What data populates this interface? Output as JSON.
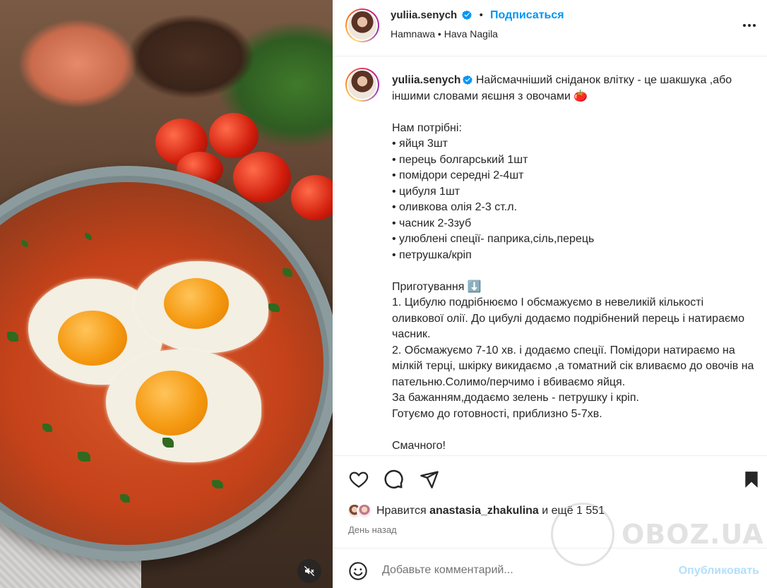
{
  "post": {
    "username": "yuliia.senych",
    "follow_label": "Подписаться",
    "audio": "Hamnawa • Hava Nagila",
    "caption": "Найсмачніший сніданок влітку - це шакшука ,або іншими словами яєшня з овочами 🍅\n\nНам потрібні:\n• яйця 3шт\n• перець болгарський 1шт\n• помідори середні 2-4шт\n• цибуля 1шт\n• оливкова олія 2-3 ст.л.\n• часник 2-3зуб\n• улюблені спеції- паприка,сіль,перець\n• петрушка/кріп\n\nПриготування ⬇️\n1. Цибулю подрібнюємо І обсмажуємо в невеликій кількості оливкової олії. До цибулі додаємо подрібнений перець і натираємо часник.\n2. Обсмажуємо 7-10 хв. і додаємо спеції. Помідори натираємо на мілкій терці, шкірку викидаємо ,а томатний сік вливаємо до овочів на пательню.Солимо/перчимо і вбиваємо яйця.\nЗа бажанням,додаємо зелень - петрушку і кріп.\nГотуємо до готовності, приблизно 5-7хв.\n\nСмачного!",
    "likes_prefix": "Нравится",
    "likes_user": "anastasia_zhakulina",
    "likes_suffix": "и ещё 1 551",
    "time": "День назад"
  },
  "comment": {
    "placeholder": "Добавьте комментарий...",
    "post_label": "Опубликовать"
  },
  "watermark": {
    "text": "OBOZ.UA"
  },
  "colors": {
    "link": "#0095f6",
    "verified": "#0095f6",
    "post_disabled": "#b2dffc"
  },
  "icons": [
    "verified-badge-icon",
    "more-options-icon",
    "heart-icon",
    "comment-icon",
    "share-icon",
    "bookmark-icon",
    "emoji-icon",
    "mute-icon"
  ]
}
